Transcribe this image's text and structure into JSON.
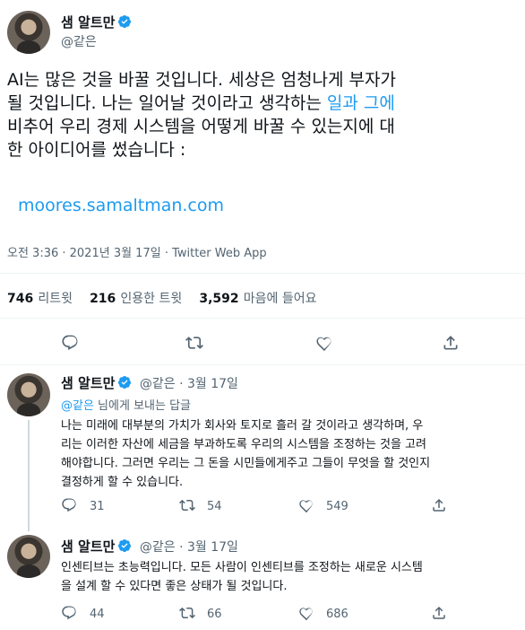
{
  "main_tweet": {
    "name": "샘 알트만",
    "handle": "@같은",
    "text_line1": "AI는 많은 것을 바꿀 것입니다. 세상은 엄청나게 부자가",
    "text_line2": "될 것입니다. 나는 일어날 것이라고 생각하는 ",
    "text_link_inline": "일과 그에",
    "text_line3": "비추어 우리 경제 시스템을 어떻게 바꿀 수 있는지에 대",
    "text_line4": "한 아이디어를 썼습니다 :",
    "link": "moores.samaltman.com",
    "timestamp": "오전 3:36 · 2021년 3월 17일 · Twitter Web App",
    "retweets_count": "746",
    "retweets_label": "리트윗",
    "quotes_count": "216",
    "quotes_label": "인용한 트윗",
    "likes_count": "3,592",
    "likes_label": "마음에 들어요"
  },
  "reply1": {
    "name": "샘 알트만",
    "handle": "@같은",
    "date": "· 3월 17일",
    "replying_handle": "@같은",
    "replying_suffix": " 님에게 보내는 답글",
    "line1": "나는 미래에 대부분의 가치가 회사와 토지로 흘러 갈 것이라고 생각하며, 우",
    "line2": "리는 이러한 자산에 세금을 부과하도록 우리의 시스템을 조정하는 것을 고려",
    "line3": "해야합니다. 그러면 우리는 그 돈을 시민들에게주고 그들이 무엇을 할 것인지",
    "line4": "결정하게 할 수 있습니다.",
    "replies": "31",
    "retweets": "54",
    "likes": "549"
  },
  "reply2": {
    "name": "샘 알트만",
    "handle": "@같은",
    "date": "· 3월 17일",
    "line1": "인센티브는 초능력입니다. 모든 사람이 인센티브를 조정하는 새로운 시스템",
    "line2": "을 설계 할 수 있다면 좋은 상태가 될 것입니다.",
    "replies": "44",
    "retweets": "66",
    "likes": "686"
  },
  "icons": {
    "verified": "verified-badge-icon",
    "reply": "reply-icon",
    "retweet": "retweet-icon",
    "like": "like-icon",
    "share": "share-icon"
  },
  "colors": {
    "accent": "#1d9bf0",
    "text": "#0f1419",
    "secondary": "#536471"
  }
}
